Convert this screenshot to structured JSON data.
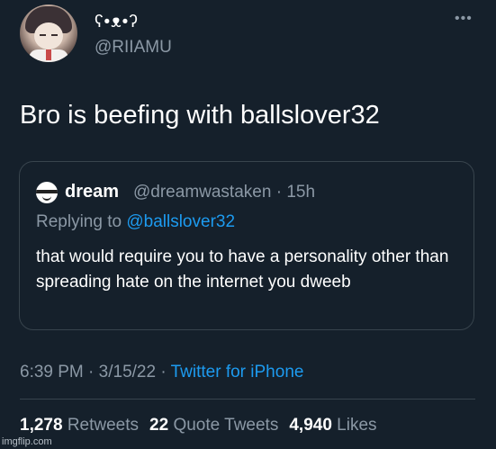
{
  "tweet": {
    "author": {
      "display_name": "ʕ•ᴥ•ʔ",
      "handle": "@RIIAMU",
      "avatar_icon": "anime-girl-avatar"
    },
    "more_label": "•••",
    "text": "Bro is beefing with ballslover32",
    "quoted": {
      "display_name": "dream",
      "handle": "@dreamwastaken",
      "separator": "·",
      "time": "15h",
      "replying_prefix": "Replying to",
      "replying_to": "@ballslover32",
      "text": "that would require you to have a personality other than spreading hate on the internet you dweeb"
    },
    "meta": {
      "time": "6:39 PM",
      "separator": "·",
      "date": "3/15/22",
      "source": "Twitter for iPhone"
    },
    "stats": {
      "retweets_count": "1,278",
      "retweets_label": "Retweets",
      "quotes_count": "22",
      "quotes_label": "Quote Tweets",
      "likes_count": "4,940",
      "likes_label": "Likes"
    }
  },
  "watermark": "imgflip.com",
  "colors": {
    "background": "#15202b",
    "secondary_text": "#8b98a5",
    "link": "#1d9bf0",
    "border": "#38444d"
  }
}
